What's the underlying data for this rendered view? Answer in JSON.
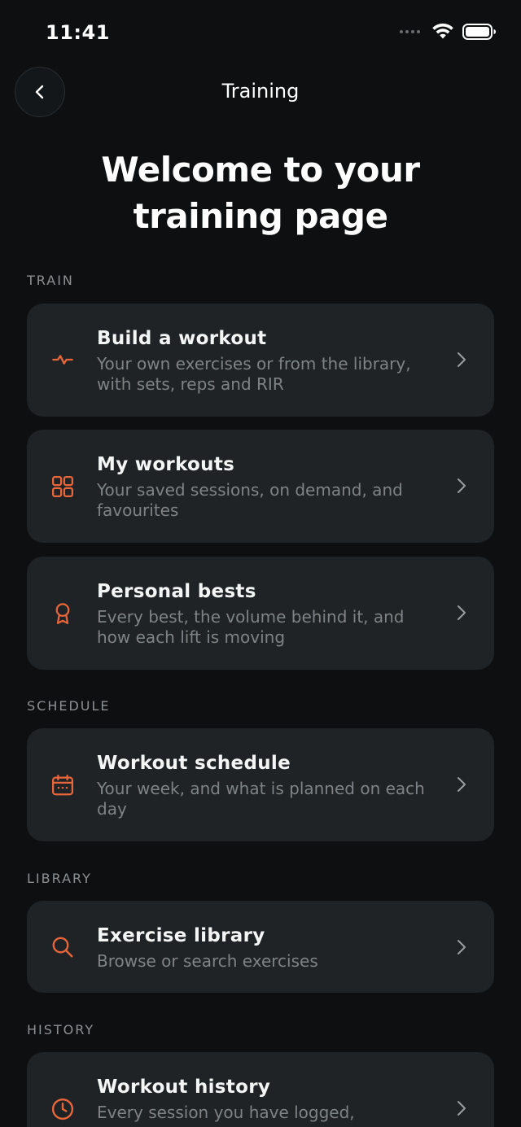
{
  "status_bar": {
    "time": "11:41"
  },
  "header": {
    "title": "Training"
  },
  "page_title": "Welcome to your training page",
  "accent_color": "#e8663a",
  "sections": {
    "train": {
      "label": "TRAIN"
    },
    "schedule": {
      "label": "SCHEDULE"
    },
    "library": {
      "label": "LIBRARY"
    },
    "history": {
      "label": "HISTORY"
    }
  },
  "cards": {
    "build_workout": {
      "title": "Build a workout",
      "subtitle": "Your own exercises or from the library, with sets, reps and RIR",
      "icon": "activity-pulse-icon"
    },
    "my_workouts": {
      "title": "My workouts",
      "subtitle": "Your saved sessions, on demand, and favourites",
      "icon": "grid-icon"
    },
    "personal_bests": {
      "title": "Personal bests",
      "subtitle": "Every best, the volume behind it, and how each lift is moving",
      "icon": "award-ribbon-icon"
    },
    "workout_schedule": {
      "title": "Workout schedule",
      "subtitle": "Your week, and what is planned on each day",
      "icon": "calendar-icon"
    },
    "exercise_library": {
      "title": "Exercise library",
      "subtitle": "Browse or search exercises",
      "icon": "search-icon"
    },
    "workout_history": {
      "title": "Workout history",
      "subtitle": "Every session you have logged,",
      "icon": "clock-icon"
    }
  }
}
